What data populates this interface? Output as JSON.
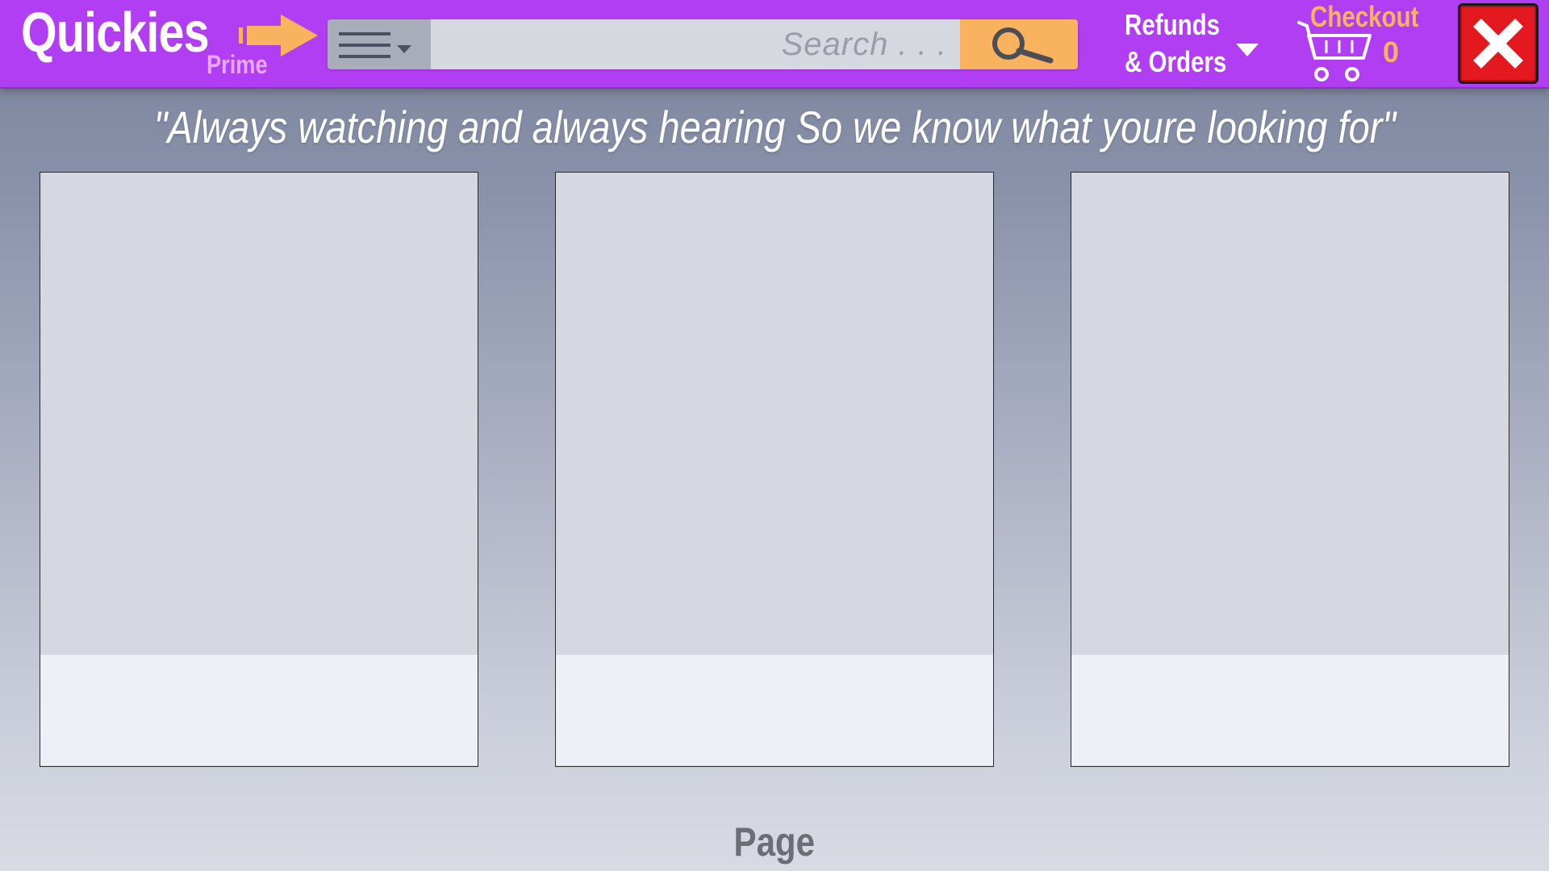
{
  "header": {
    "logo": {
      "title": "Quickies",
      "subtitle": "Prime",
      "arrow_icon": "arrow-right-icon"
    },
    "search": {
      "menu_icon": "hamburger-menu-icon",
      "placeholder": "Search . . .",
      "value": "",
      "button_icon": "search-icon"
    },
    "refunds": {
      "line1": "Refunds",
      "line2": "& Orders",
      "caret_icon": "caret-down-icon"
    },
    "checkout": {
      "label": "Checkout",
      "count": "0",
      "icon": "shopping-cart-icon"
    },
    "close_icon": "close-icon"
  },
  "main": {
    "tagline": "\"Always watching and always hearing So we know what youre looking for\"",
    "cards": [
      {
        "index": 1
      },
      {
        "index": 2
      },
      {
        "index": 3
      }
    ],
    "footer_label": "Page"
  },
  "colors": {
    "header_bg": "#b23ef3",
    "accent_orange": "#f9b35e",
    "prime_pink": "#e7a7ff",
    "close_red": "#e3191f",
    "search_field": "#d6d8df",
    "menu_button": "#a9adba",
    "card_image": "#d5d8e1",
    "card_footer": "#eff0f7"
  }
}
